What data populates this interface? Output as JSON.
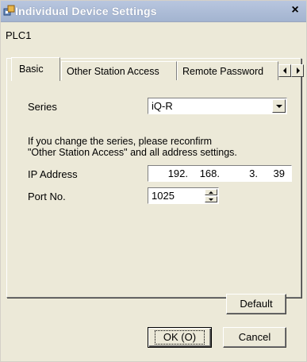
{
  "window": {
    "title": "Individual Device Settings",
    "close_glyph": "×"
  },
  "device": {
    "name": "PLC1"
  },
  "tabs": [
    {
      "label": "Basic",
      "active": true
    },
    {
      "label": "Other Station Access",
      "active": false
    },
    {
      "label": "Remote Password",
      "active": false
    }
  ],
  "form": {
    "series_label": "Series",
    "series_value": "iQ-R",
    "note_line1": "If you change the series, please reconfirm",
    "note_line2": "\"Other Station Access\" and all address settings.",
    "ip_label": "IP Address",
    "ip_octets": [
      "192.",
      "168.",
      "3.",
      "39"
    ],
    "port_label": "Port No.",
    "port_value": "1025"
  },
  "buttons": {
    "default": "Default",
    "ok": "OK (O)",
    "cancel": "Cancel"
  },
  "icons": {
    "app": "device-settings-icon",
    "close": "close-icon",
    "tab_left": "scroll-left-icon",
    "tab_right": "scroll-right-icon",
    "dropdown": "chevron-down-icon",
    "spin_up": "spin-up-icon",
    "spin_down": "spin-down-icon"
  },
  "colors": {
    "titlebar": "#a3b4d0",
    "dialog_bg": "#ece9d8"
  }
}
